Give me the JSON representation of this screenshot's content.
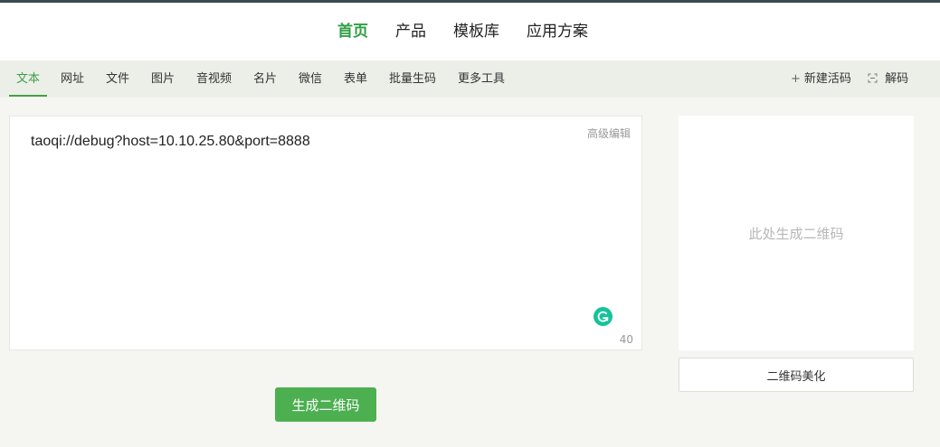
{
  "header": {
    "nav": [
      {
        "label": "首页",
        "active": true
      },
      {
        "label": "产品",
        "active": false
      },
      {
        "label": "模板库",
        "active": false
      },
      {
        "label": "应用方案",
        "active": false
      }
    ]
  },
  "tabs": [
    {
      "label": "文本",
      "active": true
    },
    {
      "label": "网址",
      "active": false
    },
    {
      "label": "文件",
      "active": false
    },
    {
      "label": "图片",
      "active": false
    },
    {
      "label": "音视频",
      "active": false
    },
    {
      "label": "名片",
      "active": false
    },
    {
      "label": "微信",
      "active": false
    },
    {
      "label": "表单",
      "active": false
    },
    {
      "label": "批量生码",
      "active": false
    },
    {
      "label": "更多工具",
      "active": false
    }
  ],
  "tools": {
    "new_live_code": {
      "icon": "plus-icon",
      "label": "新建活码"
    },
    "decode": {
      "icon": "scan-icon",
      "label": "解码"
    }
  },
  "editor": {
    "content": "taoqi://debug?host=10.10.25.80&port=8888",
    "advanced_edit_label": "高级编辑",
    "char_count": "40",
    "grammarly_icon": "grammarly-icon"
  },
  "actions": {
    "generate_label": "生成二维码",
    "beautify_label": "二维码美化"
  },
  "qr": {
    "placeholder": "此处生成二维码"
  },
  "colors": {
    "accent": "#43a047",
    "button": "#4caf50",
    "grammarly": "#15c39a"
  }
}
